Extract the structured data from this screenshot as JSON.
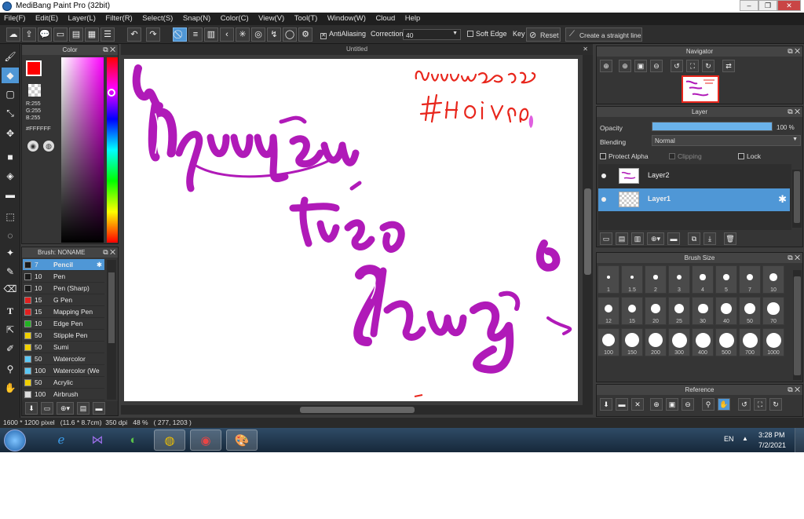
{
  "window": {
    "title": "MediBang Paint Pro (32bit)"
  },
  "menu": [
    "File(F)",
    "Edit(E)",
    "Layer(L)",
    "Filter(R)",
    "Select(S)",
    "Snap(N)",
    "Color(C)",
    "View(V)",
    "Tool(T)",
    "Window(W)",
    "Cloud",
    "Help"
  ],
  "toolbar": {
    "antialiasing_label": "AntiAliasing",
    "correction_label": "Correction",
    "correction_value": "40",
    "soft_edge_label": "Soft Edge",
    "key_label": "Key",
    "reset_label": "Reset",
    "straight_line_label": "Create a straight line"
  },
  "color_panel": {
    "title": "Color",
    "r": "R:255",
    "g": "G:255",
    "b": "B:255",
    "hex": "#FFFFFF",
    "primary": "#ff0000",
    "secondary": "#ffffff"
  },
  "canvas": {
    "tab_title": "Untitled"
  },
  "brush_panel": {
    "title": "Brush: NONAME",
    "items": [
      {
        "size": "7",
        "name": "Pencil",
        "color": "#1a1a1a"
      },
      {
        "size": "10",
        "name": "Pen",
        "color": "#1a1a1a"
      },
      {
        "size": "10",
        "name": "Pen (Sharp)",
        "color": "#1a1a1a"
      },
      {
        "size": "15",
        "name": "G Pen",
        "color": "#e02020"
      },
      {
        "size": "15",
        "name": "Mapping Pen",
        "color": "#e02020"
      },
      {
        "size": "10",
        "name": "Edge Pen",
        "color": "#22b022"
      },
      {
        "size": "50",
        "name": "Stipple Pen",
        "color": "#f0d000"
      },
      {
        "size": "50",
        "name": "Sumi",
        "color": "#f0d000"
      },
      {
        "size": "50",
        "name": "Watercolor",
        "color": "#5bc8f5"
      },
      {
        "size": "100",
        "name": "Watercolor (We",
        "color": "#5bc8f5"
      },
      {
        "size": "50",
        "name": "Acrylic",
        "color": "#f0d000"
      },
      {
        "size": "100",
        "name": "Airbrush",
        "color": "#dddddd"
      }
    ]
  },
  "navigator": {
    "title": "Navigator"
  },
  "layer_panel": {
    "title": "Layer",
    "opacity_label": "Opacity",
    "opacity_value": "100 %",
    "opacity_fraction": 1.0,
    "blending_label": "Blending",
    "blending_value": "Normal",
    "protect_alpha_label": "Protect Alpha",
    "clipping_label": "Clipping",
    "lock_label": "Lock",
    "layers": [
      {
        "name": "Layer2",
        "selected": false
      },
      {
        "name": "Layer1",
        "selected": true
      }
    ]
  },
  "brush_size_panel": {
    "title": "Brush Size",
    "sizes": [
      "1",
      "1.5",
      "2",
      "3",
      "4",
      "5",
      "7",
      "10",
      "12",
      "15",
      "20",
      "25",
      "30",
      "40",
      "50",
      "70",
      "100",
      "150",
      "200",
      "300",
      "400",
      "500",
      "700",
      "1000"
    ]
  },
  "reference_panel": {
    "title": "Reference"
  },
  "status_bar": {
    "text": "1600 * 1200 pixel   (11.6 * 8.7cm)  350 dpi   48 %   ( 277, 1203 )"
  },
  "taskbar": {
    "language": "EN",
    "time": "3:28 PM",
    "date": "7/2/2021"
  }
}
